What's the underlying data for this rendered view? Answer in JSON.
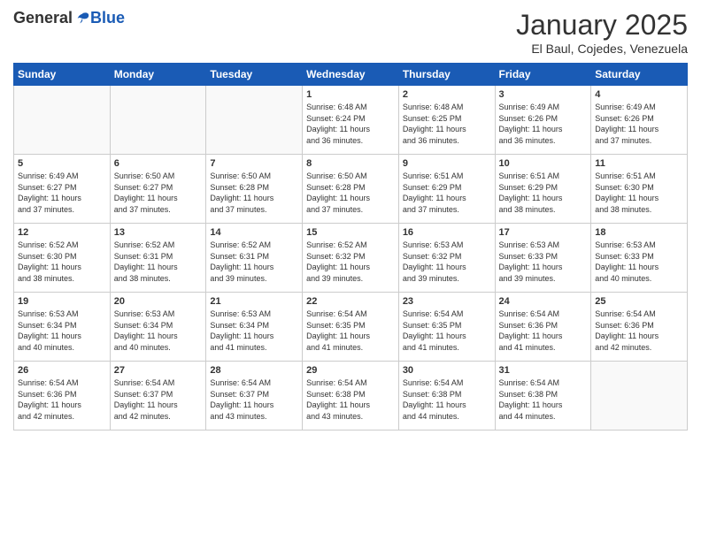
{
  "logo": {
    "general": "General",
    "blue": "Blue"
  },
  "title": "January 2025",
  "subtitle": "El Baul, Cojedes, Venezuela",
  "weekdays": [
    "Sunday",
    "Monday",
    "Tuesday",
    "Wednesday",
    "Thursday",
    "Friday",
    "Saturday"
  ],
  "weeks": [
    [
      {
        "day": "",
        "info": ""
      },
      {
        "day": "",
        "info": ""
      },
      {
        "day": "",
        "info": ""
      },
      {
        "day": "1",
        "info": "Sunrise: 6:48 AM\nSunset: 6:24 PM\nDaylight: 11 hours\nand 36 minutes."
      },
      {
        "day": "2",
        "info": "Sunrise: 6:48 AM\nSunset: 6:25 PM\nDaylight: 11 hours\nand 36 minutes."
      },
      {
        "day": "3",
        "info": "Sunrise: 6:49 AM\nSunset: 6:26 PM\nDaylight: 11 hours\nand 36 minutes."
      },
      {
        "day": "4",
        "info": "Sunrise: 6:49 AM\nSunset: 6:26 PM\nDaylight: 11 hours\nand 37 minutes."
      }
    ],
    [
      {
        "day": "5",
        "info": "Sunrise: 6:49 AM\nSunset: 6:27 PM\nDaylight: 11 hours\nand 37 minutes."
      },
      {
        "day": "6",
        "info": "Sunrise: 6:50 AM\nSunset: 6:27 PM\nDaylight: 11 hours\nand 37 minutes."
      },
      {
        "day": "7",
        "info": "Sunrise: 6:50 AM\nSunset: 6:28 PM\nDaylight: 11 hours\nand 37 minutes."
      },
      {
        "day": "8",
        "info": "Sunrise: 6:50 AM\nSunset: 6:28 PM\nDaylight: 11 hours\nand 37 minutes."
      },
      {
        "day": "9",
        "info": "Sunrise: 6:51 AM\nSunset: 6:29 PM\nDaylight: 11 hours\nand 37 minutes."
      },
      {
        "day": "10",
        "info": "Sunrise: 6:51 AM\nSunset: 6:29 PM\nDaylight: 11 hours\nand 38 minutes."
      },
      {
        "day": "11",
        "info": "Sunrise: 6:51 AM\nSunset: 6:30 PM\nDaylight: 11 hours\nand 38 minutes."
      }
    ],
    [
      {
        "day": "12",
        "info": "Sunrise: 6:52 AM\nSunset: 6:30 PM\nDaylight: 11 hours\nand 38 minutes."
      },
      {
        "day": "13",
        "info": "Sunrise: 6:52 AM\nSunset: 6:31 PM\nDaylight: 11 hours\nand 38 minutes."
      },
      {
        "day": "14",
        "info": "Sunrise: 6:52 AM\nSunset: 6:31 PM\nDaylight: 11 hours\nand 39 minutes."
      },
      {
        "day": "15",
        "info": "Sunrise: 6:52 AM\nSunset: 6:32 PM\nDaylight: 11 hours\nand 39 minutes."
      },
      {
        "day": "16",
        "info": "Sunrise: 6:53 AM\nSunset: 6:32 PM\nDaylight: 11 hours\nand 39 minutes."
      },
      {
        "day": "17",
        "info": "Sunrise: 6:53 AM\nSunset: 6:33 PM\nDaylight: 11 hours\nand 39 minutes."
      },
      {
        "day": "18",
        "info": "Sunrise: 6:53 AM\nSunset: 6:33 PM\nDaylight: 11 hours\nand 40 minutes."
      }
    ],
    [
      {
        "day": "19",
        "info": "Sunrise: 6:53 AM\nSunset: 6:34 PM\nDaylight: 11 hours\nand 40 minutes."
      },
      {
        "day": "20",
        "info": "Sunrise: 6:53 AM\nSunset: 6:34 PM\nDaylight: 11 hours\nand 40 minutes."
      },
      {
        "day": "21",
        "info": "Sunrise: 6:53 AM\nSunset: 6:34 PM\nDaylight: 11 hours\nand 41 minutes."
      },
      {
        "day": "22",
        "info": "Sunrise: 6:54 AM\nSunset: 6:35 PM\nDaylight: 11 hours\nand 41 minutes."
      },
      {
        "day": "23",
        "info": "Sunrise: 6:54 AM\nSunset: 6:35 PM\nDaylight: 11 hours\nand 41 minutes."
      },
      {
        "day": "24",
        "info": "Sunrise: 6:54 AM\nSunset: 6:36 PM\nDaylight: 11 hours\nand 41 minutes."
      },
      {
        "day": "25",
        "info": "Sunrise: 6:54 AM\nSunset: 6:36 PM\nDaylight: 11 hours\nand 42 minutes."
      }
    ],
    [
      {
        "day": "26",
        "info": "Sunrise: 6:54 AM\nSunset: 6:36 PM\nDaylight: 11 hours\nand 42 minutes."
      },
      {
        "day": "27",
        "info": "Sunrise: 6:54 AM\nSunset: 6:37 PM\nDaylight: 11 hours\nand 42 minutes."
      },
      {
        "day": "28",
        "info": "Sunrise: 6:54 AM\nSunset: 6:37 PM\nDaylight: 11 hours\nand 43 minutes."
      },
      {
        "day": "29",
        "info": "Sunrise: 6:54 AM\nSunset: 6:38 PM\nDaylight: 11 hours\nand 43 minutes."
      },
      {
        "day": "30",
        "info": "Sunrise: 6:54 AM\nSunset: 6:38 PM\nDaylight: 11 hours\nand 44 minutes."
      },
      {
        "day": "31",
        "info": "Sunrise: 6:54 AM\nSunset: 6:38 PM\nDaylight: 11 hours\nand 44 minutes."
      },
      {
        "day": "",
        "info": ""
      }
    ]
  ]
}
